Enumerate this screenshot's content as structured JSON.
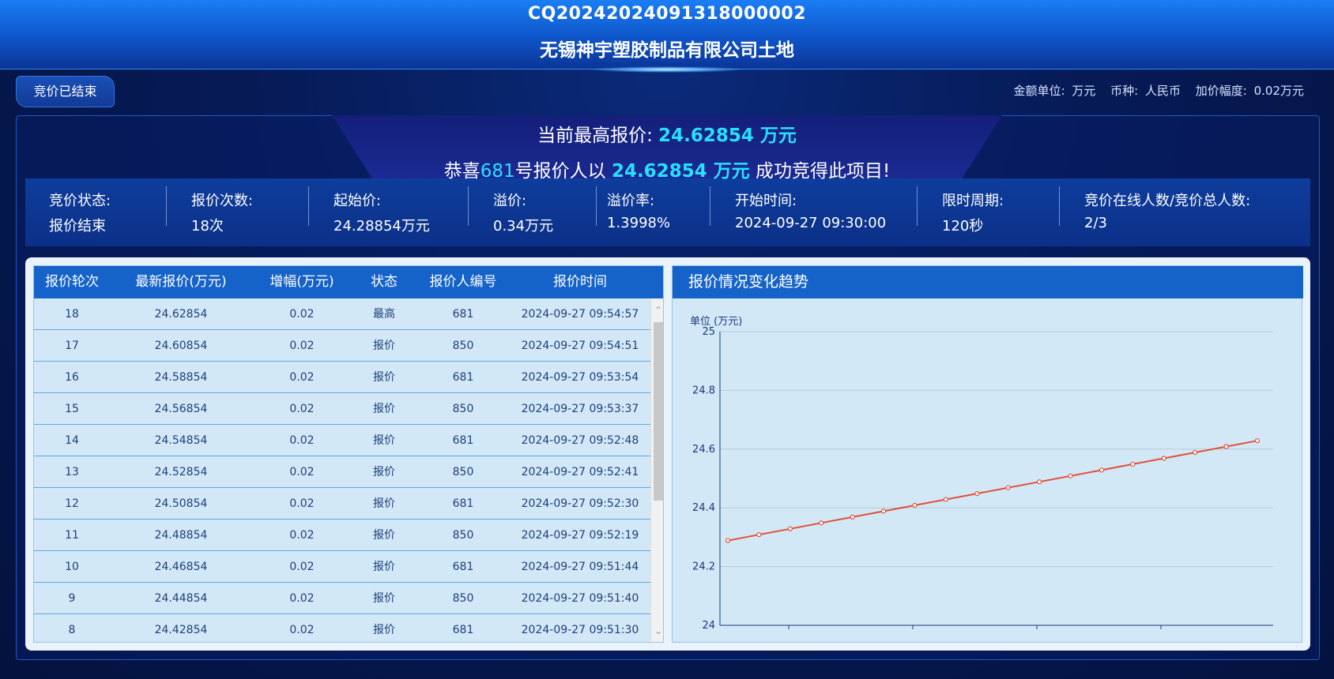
{
  "header": {
    "code": "CQ20242024091318000002",
    "name": "无锡神宇塑胶制品有限公司土地"
  },
  "status_button": "竞价已结束",
  "units": {
    "amount_label": "金额单位:",
    "amount_value": "万元",
    "currency_label": "币种:",
    "currency_value": "人民币",
    "increment_label": "加价幅度:",
    "increment_value": "0.02万元"
  },
  "summary": {
    "highest_label": "当前最高报价:",
    "highest_value": "24.62854 万元",
    "congrats_prefix": "恭喜",
    "winner_no": "681",
    "congrats_mid": "号报价人以",
    "congrats_value": "24.62854 万元",
    "congrats_suffix": "成功竞得此项目!"
  },
  "stats": [
    {
      "label": "竞价状态:",
      "value": "报价结束"
    },
    {
      "label": "报价次数:",
      "value": "18次"
    },
    {
      "label": "起始价:",
      "value": "24.28854万元"
    },
    {
      "label": "溢价:",
      "value": "0.34万元"
    },
    {
      "label": "溢价率:",
      "value": "1.3998%"
    },
    {
      "label": "开始时间:",
      "value": "2024-09-27 09:30:00"
    },
    {
      "label": "限时周期:",
      "value": "120秒"
    },
    {
      "label": "竞价在线人数/竞价总人数:",
      "value": "2/3"
    }
  ],
  "table": {
    "headers": [
      "报价轮次",
      "最新报价(万元)",
      "增幅(万元)",
      "状态",
      "报价人编号",
      "报价时间"
    ],
    "rows": [
      [
        "18",
        "24.62854",
        "0.02",
        "最高",
        "681",
        "2024-09-27 09:54:57"
      ],
      [
        "17",
        "24.60854",
        "0.02",
        "报价",
        "850",
        "2024-09-27 09:54:51"
      ],
      [
        "16",
        "24.58854",
        "0.02",
        "报价",
        "681",
        "2024-09-27 09:53:54"
      ],
      [
        "15",
        "24.56854",
        "0.02",
        "报价",
        "850",
        "2024-09-27 09:53:37"
      ],
      [
        "14",
        "24.54854",
        "0.02",
        "报价",
        "681",
        "2024-09-27 09:52:48"
      ],
      [
        "13",
        "24.52854",
        "0.02",
        "报价",
        "850",
        "2024-09-27 09:52:41"
      ],
      [
        "12",
        "24.50854",
        "0.02",
        "报价",
        "681",
        "2024-09-27 09:52:30"
      ],
      [
        "11",
        "24.48854",
        "0.02",
        "报价",
        "850",
        "2024-09-27 09:52:19"
      ],
      [
        "10",
        "24.46854",
        "0.02",
        "报价",
        "681",
        "2024-09-27 09:51:44"
      ],
      [
        "9",
        "24.44854",
        "0.02",
        "报价",
        "850",
        "2024-09-27 09:51:40"
      ],
      [
        "8",
        "24.42854",
        "0.02",
        "报价",
        "681",
        "2024-09-27 09:51:30"
      ]
    ]
  },
  "chart": {
    "title": "报价情况变化趋势",
    "unit": "单位 (万元)"
  },
  "chart_data": {
    "type": "line",
    "x": [
      1,
      2,
      3,
      4,
      5,
      6,
      7,
      8,
      9,
      10,
      11,
      12,
      13,
      14,
      15,
      16,
      17,
      18
    ],
    "series": [
      {
        "values": [
          24.28854,
          24.30854,
          24.32854,
          24.34854,
          24.36854,
          24.38854,
          24.40854,
          24.42854,
          24.44854,
          24.46854,
          24.48854,
          24.50854,
          24.52854,
          24.54854,
          24.56854,
          24.58854,
          24.60854,
          24.62854
        ]
      }
    ],
    "ylabel": "单位 (万元)",
    "ylim": [
      24,
      25
    ],
    "yticks": [
      "24",
      "24.2",
      "24.4",
      "24.6",
      "24.8",
      "25"
    ],
    "grid": true,
    "line_color": "#e0503a"
  },
  "colors": {
    "accent": "#28e0ff",
    "header_blue": "#1563c9"
  }
}
